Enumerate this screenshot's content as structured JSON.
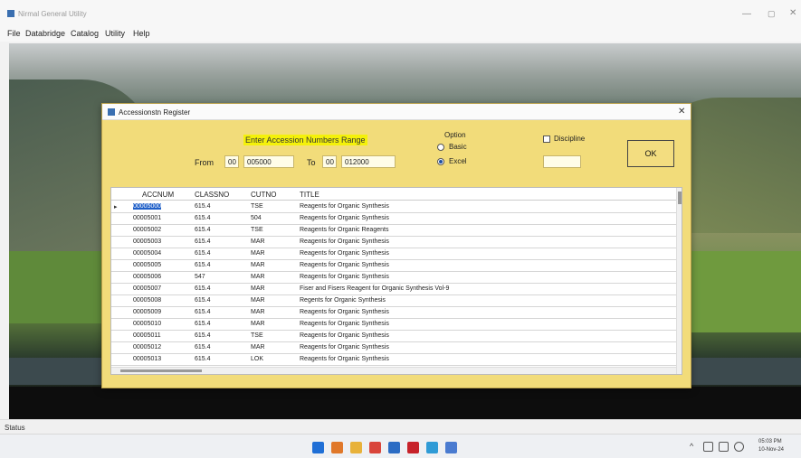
{
  "app": {
    "title": "Nirmal General Utility",
    "window_controls": {
      "minimize": "—",
      "maximize": "▢",
      "close": "✕"
    }
  },
  "menu": [
    "File",
    "Databridge",
    "Catalog",
    "Utility",
    "Help"
  ],
  "dialog": {
    "title": "Accessionstn Register",
    "close": "✕",
    "range_heading": "Enter Accession Numbers Range",
    "from_label": "From",
    "from_prefix": "00",
    "from_value": "005000",
    "to_label": "To",
    "to_prefix": "00",
    "to_value": "012000",
    "option_label": "Option",
    "options": [
      {
        "label": "Basic",
        "selected": false
      },
      {
        "label": "Excel",
        "selected": true
      }
    ],
    "discipline_label": "Discipline",
    "discipline_checked": false,
    "discipline_value": "",
    "ok_label": "OK"
  },
  "grid": {
    "columns": [
      "ACCNUM",
      "CLASSNO",
      "CUTNO",
      "TITLE"
    ],
    "selected_row": 0,
    "rows": [
      {
        "accnum": "00005000",
        "classno": "615.4",
        "cutno": "TSE",
        "title": "Reagents for Organic Synthesis"
      },
      {
        "accnum": "00005001",
        "classno": "615.4",
        "cutno": "504",
        "title": "Reagents for Organic Synthesis"
      },
      {
        "accnum": "00005002",
        "classno": "615.4",
        "cutno": "TSE",
        "title": "Reagents for Organic Reagents"
      },
      {
        "accnum": "00005003",
        "classno": "615.4",
        "cutno": "MAR",
        "title": "Reagents for Organic Synthesis"
      },
      {
        "accnum": "00005004",
        "classno": "615.4",
        "cutno": "MAR",
        "title": "Reagents for Organic Synthesis"
      },
      {
        "accnum": "00005005",
        "classno": "615.4",
        "cutno": "MAR",
        "title": "Reagents for Organic Synthesis"
      },
      {
        "accnum": "00005006",
        "classno": "547",
        "cutno": "MAR",
        "title": "Reagents for Organic Synthesis"
      },
      {
        "accnum": "00005007",
        "classno": "615.4",
        "cutno": "MAR",
        "title": "Fiser and Fisers Reagent for Organic Synthesis Vol-9"
      },
      {
        "accnum": "00005008",
        "classno": "615.4",
        "cutno": "MAR",
        "title": "Regents for Organic Synthesis"
      },
      {
        "accnum": "00005009",
        "classno": "615.4",
        "cutno": "MAR",
        "title": "Reagents for Organic Synthesis"
      },
      {
        "accnum": "00005010",
        "classno": "615.4",
        "cutno": "MAR",
        "title": "Reagents for Organic Synthesis"
      },
      {
        "accnum": "00005011",
        "classno": "615.4",
        "cutno": "TSE",
        "title": "Reagents for Organic Synthesis"
      },
      {
        "accnum": "00005012",
        "classno": "615.4",
        "cutno": "MAR",
        "title": "Reagents for Organic Synthesis"
      },
      {
        "accnum": "00005013",
        "classno": "615.4",
        "cutno": "LOK",
        "title": "Reagents for Organic Synthesis"
      }
    ]
  },
  "status": {
    "text": "Status"
  },
  "taskbar": {
    "icons": [
      {
        "name": "start-icon",
        "color": "#1f6fd6"
      },
      {
        "name": "widgets-icon",
        "color": "#e0782a"
      },
      {
        "name": "file-explorer-icon",
        "color": "#e8b23a"
      },
      {
        "name": "chrome-icon",
        "color": "#d9453b"
      },
      {
        "name": "mail-icon",
        "color": "#2b6cc4"
      },
      {
        "name": "pdf-icon",
        "color": "#c7222a"
      },
      {
        "name": "app-icon",
        "color": "#2f9bd6"
      },
      {
        "name": "window-icon",
        "color": "#4a7bd0"
      }
    ],
    "tray_chevron": "^",
    "time": "05:03 PM",
    "date": "10-Nov-24"
  }
}
